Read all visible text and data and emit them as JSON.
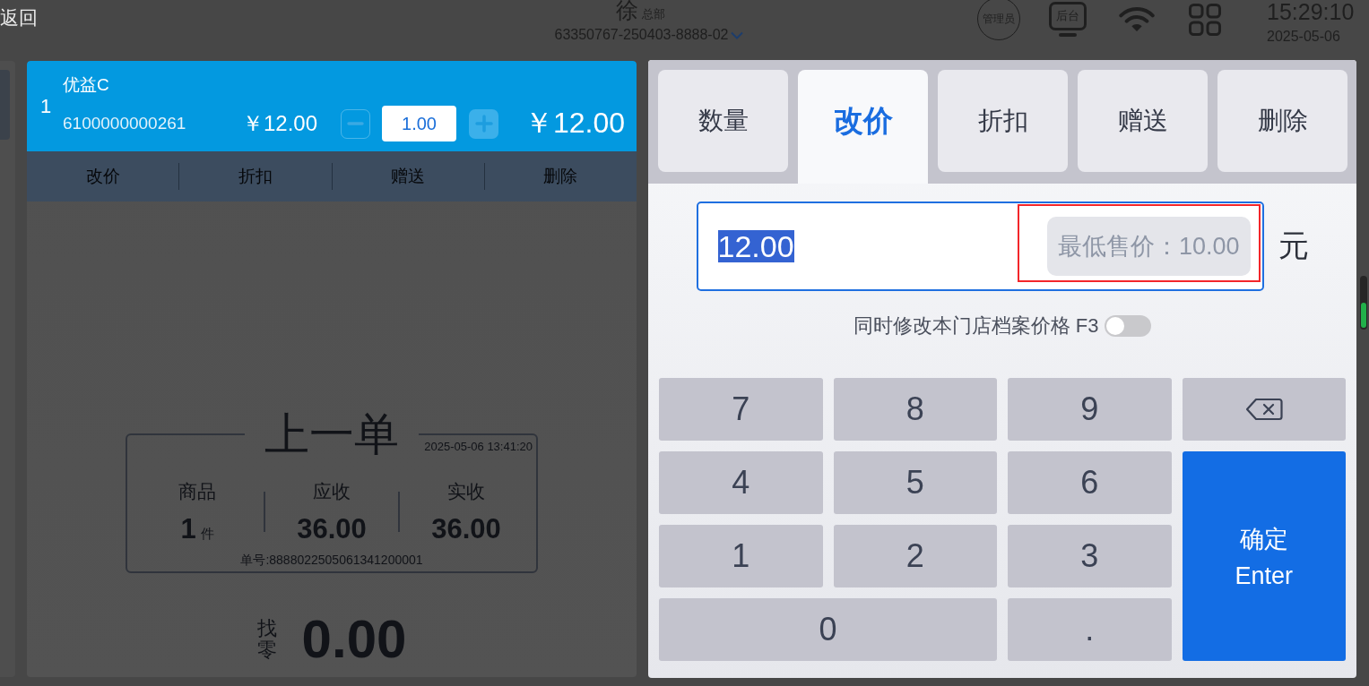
{
  "top_bar": {
    "back": "返回",
    "store_name": "徐",
    "store_branch": "总部",
    "device_id": "63350767-250403-8888-02",
    "role": "管理员",
    "backoffice": "后台",
    "time": "15:29:10",
    "date": "2025-05-06"
  },
  "cart": {
    "items": [
      {
        "index": "1",
        "name": "优益C",
        "barcode": "6100000000261",
        "price": "￥12.00",
        "quantity": "1.00",
        "total": "￥12.00",
        "selected": true,
        "decrease_disabled": true
      }
    ],
    "item_actions": [
      "改价",
      "折扣",
      "赠送",
      "删除"
    ]
  },
  "last_order": {
    "title": "上一单",
    "time": "2025-05-06 13:41:20",
    "stats": [
      {
        "label": "商品",
        "value": "1",
        "unit": "件"
      },
      {
        "label": "应收",
        "value": "36.00"
      },
      {
        "label": "实收",
        "value": "36.00"
      }
    ],
    "order_no": "单号:8888022505061341200001"
  },
  "change": {
    "label": "找零",
    "value": "0.00"
  },
  "dialog": {
    "tabs": [
      {
        "label": "数量",
        "selected": false
      },
      {
        "label": "改价",
        "selected": true
      },
      {
        "label": "折扣",
        "selected": false
      },
      {
        "label": "赠送",
        "selected": false
      },
      {
        "label": "删除",
        "selected": false
      }
    ],
    "price_input": {
      "value": "12.00",
      "value_selected": true,
      "min_price": "最低售价：10.00",
      "min_price_marked": true,
      "unit": "元"
    },
    "sync_option": {
      "label": "同时修改本门店档案价格 F3",
      "on": false
    },
    "keypad": [
      {
        "kind": "digit",
        "label": "7"
      },
      {
        "kind": "digit",
        "label": "8"
      },
      {
        "kind": "digit",
        "label": "9"
      },
      {
        "kind": "backspace"
      },
      {
        "kind": "digit",
        "label": "4"
      },
      {
        "kind": "digit",
        "label": "5"
      },
      {
        "kind": "digit",
        "label": "6"
      },
      {
        "kind": "digit",
        "label": "1"
      },
      {
        "kind": "digit",
        "label": "2"
      },
      {
        "kind": "digit",
        "label": "3"
      },
      {
        "kind": "wide",
        "label": "0"
      },
      {
        "kind": "digit",
        "label": "."
      },
      {
        "kind": "confirm",
        "label": "确定",
        "sublabel": "Enter"
      }
    ]
  }
}
